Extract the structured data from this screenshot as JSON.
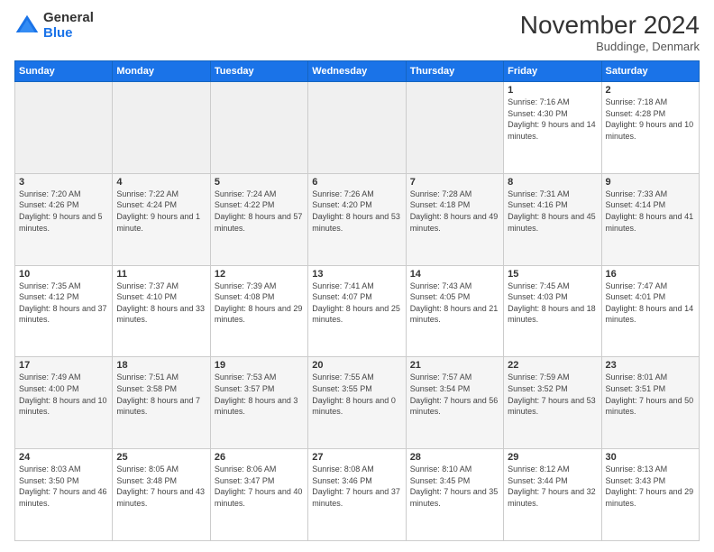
{
  "header": {
    "logo_general": "General",
    "logo_blue": "Blue",
    "month_title": "November 2024",
    "location": "Buddinge, Denmark"
  },
  "days_of_week": [
    "Sunday",
    "Monday",
    "Tuesday",
    "Wednesday",
    "Thursday",
    "Friday",
    "Saturday"
  ],
  "weeks": [
    [
      {
        "day": "",
        "info": ""
      },
      {
        "day": "",
        "info": ""
      },
      {
        "day": "",
        "info": ""
      },
      {
        "day": "",
        "info": ""
      },
      {
        "day": "",
        "info": ""
      },
      {
        "day": "1",
        "info": "Sunrise: 7:16 AM\nSunset: 4:30 PM\nDaylight: 9 hours and 14 minutes."
      },
      {
        "day": "2",
        "info": "Sunrise: 7:18 AM\nSunset: 4:28 PM\nDaylight: 9 hours and 10 minutes."
      }
    ],
    [
      {
        "day": "3",
        "info": "Sunrise: 7:20 AM\nSunset: 4:26 PM\nDaylight: 9 hours and 5 minutes."
      },
      {
        "day": "4",
        "info": "Sunrise: 7:22 AM\nSunset: 4:24 PM\nDaylight: 9 hours and 1 minute."
      },
      {
        "day": "5",
        "info": "Sunrise: 7:24 AM\nSunset: 4:22 PM\nDaylight: 8 hours and 57 minutes."
      },
      {
        "day": "6",
        "info": "Sunrise: 7:26 AM\nSunset: 4:20 PM\nDaylight: 8 hours and 53 minutes."
      },
      {
        "day": "7",
        "info": "Sunrise: 7:28 AM\nSunset: 4:18 PM\nDaylight: 8 hours and 49 minutes."
      },
      {
        "day": "8",
        "info": "Sunrise: 7:31 AM\nSunset: 4:16 PM\nDaylight: 8 hours and 45 minutes."
      },
      {
        "day": "9",
        "info": "Sunrise: 7:33 AM\nSunset: 4:14 PM\nDaylight: 8 hours and 41 minutes."
      }
    ],
    [
      {
        "day": "10",
        "info": "Sunrise: 7:35 AM\nSunset: 4:12 PM\nDaylight: 8 hours and 37 minutes."
      },
      {
        "day": "11",
        "info": "Sunrise: 7:37 AM\nSunset: 4:10 PM\nDaylight: 8 hours and 33 minutes."
      },
      {
        "day": "12",
        "info": "Sunrise: 7:39 AM\nSunset: 4:08 PM\nDaylight: 8 hours and 29 minutes."
      },
      {
        "day": "13",
        "info": "Sunrise: 7:41 AM\nSunset: 4:07 PM\nDaylight: 8 hours and 25 minutes."
      },
      {
        "day": "14",
        "info": "Sunrise: 7:43 AM\nSunset: 4:05 PM\nDaylight: 8 hours and 21 minutes."
      },
      {
        "day": "15",
        "info": "Sunrise: 7:45 AM\nSunset: 4:03 PM\nDaylight: 8 hours and 18 minutes."
      },
      {
        "day": "16",
        "info": "Sunrise: 7:47 AM\nSunset: 4:01 PM\nDaylight: 8 hours and 14 minutes."
      }
    ],
    [
      {
        "day": "17",
        "info": "Sunrise: 7:49 AM\nSunset: 4:00 PM\nDaylight: 8 hours and 10 minutes."
      },
      {
        "day": "18",
        "info": "Sunrise: 7:51 AM\nSunset: 3:58 PM\nDaylight: 8 hours and 7 minutes."
      },
      {
        "day": "19",
        "info": "Sunrise: 7:53 AM\nSunset: 3:57 PM\nDaylight: 8 hours and 3 minutes."
      },
      {
        "day": "20",
        "info": "Sunrise: 7:55 AM\nSunset: 3:55 PM\nDaylight: 8 hours and 0 minutes."
      },
      {
        "day": "21",
        "info": "Sunrise: 7:57 AM\nSunset: 3:54 PM\nDaylight: 7 hours and 56 minutes."
      },
      {
        "day": "22",
        "info": "Sunrise: 7:59 AM\nSunset: 3:52 PM\nDaylight: 7 hours and 53 minutes."
      },
      {
        "day": "23",
        "info": "Sunrise: 8:01 AM\nSunset: 3:51 PM\nDaylight: 7 hours and 50 minutes."
      }
    ],
    [
      {
        "day": "24",
        "info": "Sunrise: 8:03 AM\nSunset: 3:50 PM\nDaylight: 7 hours and 46 minutes."
      },
      {
        "day": "25",
        "info": "Sunrise: 8:05 AM\nSunset: 3:48 PM\nDaylight: 7 hours and 43 minutes."
      },
      {
        "day": "26",
        "info": "Sunrise: 8:06 AM\nSunset: 3:47 PM\nDaylight: 7 hours and 40 minutes."
      },
      {
        "day": "27",
        "info": "Sunrise: 8:08 AM\nSunset: 3:46 PM\nDaylight: 7 hours and 37 minutes."
      },
      {
        "day": "28",
        "info": "Sunrise: 8:10 AM\nSunset: 3:45 PM\nDaylight: 7 hours and 35 minutes."
      },
      {
        "day": "29",
        "info": "Sunrise: 8:12 AM\nSunset: 3:44 PM\nDaylight: 7 hours and 32 minutes."
      },
      {
        "day": "30",
        "info": "Sunrise: 8:13 AM\nSunset: 3:43 PM\nDaylight: 7 hours and 29 minutes."
      }
    ]
  ]
}
